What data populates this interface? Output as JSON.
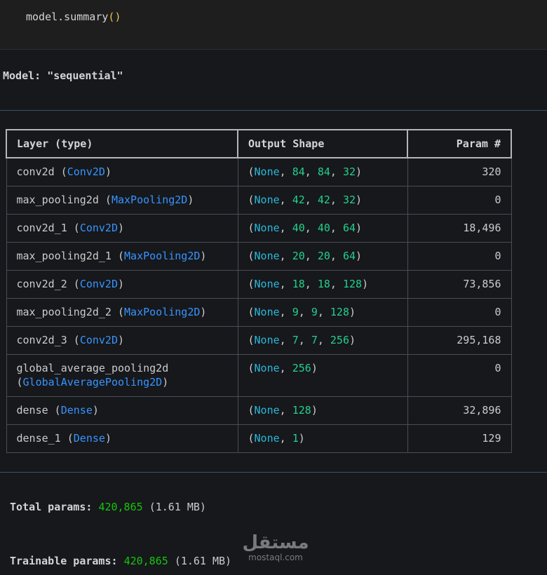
{
  "code_cell": {
    "text": "model.summary",
    "open_paren": "(",
    "close_paren": ")"
  },
  "model_title": "Model: \"sequential\"",
  "table": {
    "headers": {
      "layer": "Layer (type)",
      "shape": "Output Shape",
      "param": "Param #"
    },
    "rows": [
      {
        "name": "conv2d",
        "cls": "Conv2D",
        "shape": [
          "None",
          "84",
          "84",
          "32"
        ],
        "param": "320"
      },
      {
        "name": "max_pooling2d",
        "cls": "MaxPooling2D",
        "shape": [
          "None",
          "42",
          "42",
          "32"
        ],
        "param": "0"
      },
      {
        "name": "conv2d_1",
        "cls": "Conv2D",
        "shape": [
          "None",
          "40",
          "40",
          "64"
        ],
        "param": "18,496"
      },
      {
        "name": "max_pooling2d_1",
        "cls": "MaxPooling2D",
        "shape": [
          "None",
          "20",
          "20",
          "64"
        ],
        "param": "0"
      },
      {
        "name": "conv2d_2",
        "cls": "Conv2D",
        "shape": [
          "None",
          "18",
          "18",
          "128"
        ],
        "param": "73,856"
      },
      {
        "name": "max_pooling2d_2",
        "cls": "MaxPooling2D",
        "shape": [
          "None",
          "9",
          "9",
          "128"
        ],
        "param": "0"
      },
      {
        "name": "conv2d_3",
        "cls": "Conv2D",
        "shape": [
          "None",
          "7",
          "7",
          "256"
        ],
        "param": "295,168"
      },
      {
        "name": "global_average_pooling2d",
        "cls": "GlobalAveragePooling2D",
        "shape": [
          "None",
          "256"
        ],
        "param": "0",
        "wrap": true
      },
      {
        "name": "dense",
        "cls": "Dense",
        "shape": [
          "None",
          "128"
        ],
        "param": "32,896"
      },
      {
        "name": "dense_1",
        "cls": "Dense",
        "shape": [
          "None",
          "1"
        ],
        "param": "129"
      }
    ]
  },
  "totals": {
    "total": {
      "label": "Total params:",
      "value": "420,865",
      "size": "(1.61 MB)"
    },
    "trainable": {
      "label": "Trainable params:",
      "value": "420,865",
      "size": "(1.61 MB)"
    }
  },
  "watermark": {
    "logo": "مستقل",
    "domain": "mostaql.com"
  },
  "colors": {
    "background": "#16181c",
    "class_name": "#3794ff",
    "none": "#29b8db",
    "number": "#23d18b",
    "param": "#16c60c",
    "paren": "#e7c547"
  }
}
